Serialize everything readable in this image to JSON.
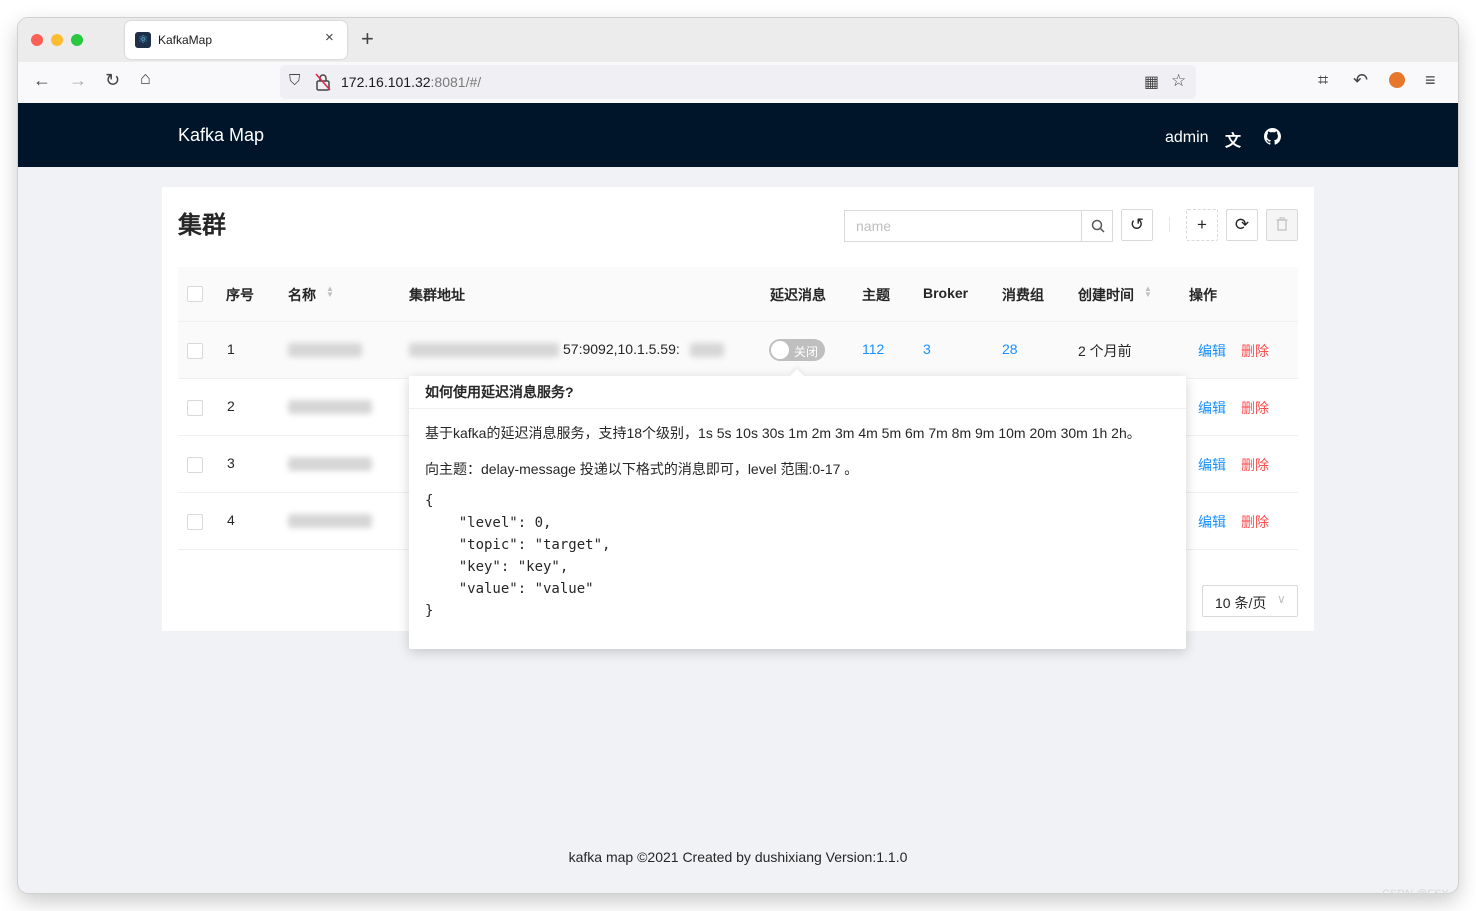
{
  "browser": {
    "tab_title": "KafkaMap",
    "tab_close": "×",
    "new_tab": "+",
    "url_host": "172.16.101.32",
    "url_rest": ":8081/#/"
  },
  "header": {
    "brand": "Kafka Map",
    "user": "admin"
  },
  "page": {
    "title": "集群",
    "search_placeholder": "name"
  },
  "table": {
    "columns": {
      "index": "序号",
      "name": "名称",
      "address": "集群地址",
      "delay": "延迟消息",
      "topics": "主题",
      "broker": "Broker",
      "consumer_groups": "消费组",
      "created": "创建时间",
      "actions": "操作"
    },
    "rows": [
      {
        "index": "1",
        "address_visible": "57:9092,10.1.5.59:",
        "delay_switch": "关闭",
        "topics": "112",
        "broker": "3",
        "consumer_groups": "28",
        "created": "2 个月前",
        "edit": "编辑",
        "delete": "删除"
      },
      {
        "index": "2",
        "edit": "编辑",
        "delete": "删除"
      },
      {
        "index": "3",
        "edit": "编辑",
        "delete": "删除"
      },
      {
        "index": "4",
        "edit": "编辑",
        "delete": "删除"
      }
    ],
    "page_size": "10 条/页"
  },
  "popover": {
    "title": "如何使用延迟消息服务?",
    "line1": "基于kafka的延迟消息服务，支持18个级别，1s 5s 10s 30s 1m 2m 3m 4m 5m 6m 7m 8m 9m 10m 20m 30m 1h 2h。",
    "line2": "向主题：delay-message 投递以下格式的消息即可，level 范围:0-17 。",
    "code": "{\n    \"level\": 0,\n    \"topic\": \"target\",\n    \"key\": \"key\",\n    \"value\": \"value\"\n}"
  },
  "footer": "kafka map ©2021 Created by dushixiang Version:1.1.0",
  "watermark": "CSDN @FSY",
  "colors": {
    "header_bg": "#001529",
    "link": "#1890ff",
    "danger": "#ff4d4f",
    "switch_off": "#bfbfbf"
  }
}
